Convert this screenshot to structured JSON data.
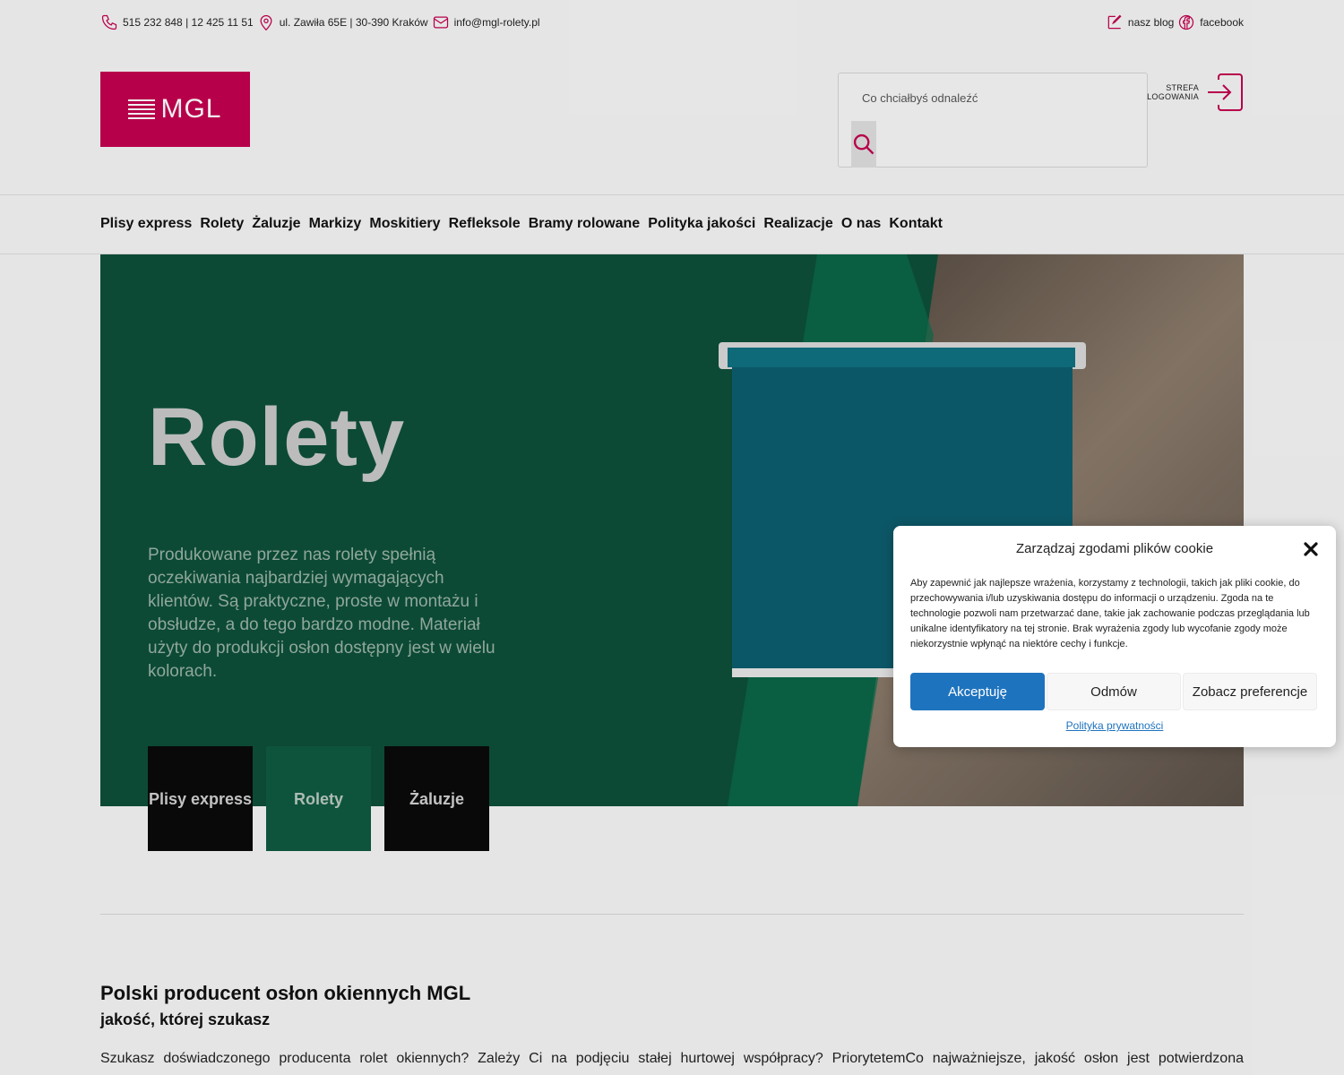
{
  "topbar": {
    "phone": "515 232 848 | 12 425 11 51",
    "address": "ul. Zawiła 65E | 30-390 Kraków",
    "email": "info@mgl-rolety.pl",
    "blog": "nasz blog",
    "facebook": "facebook"
  },
  "header": {
    "logo_text": "MGL",
    "search_placeholder": "Co chciałbyś odnaleźć",
    "login_line1": "STREFA",
    "login_line2": "LOGOWANIA"
  },
  "nav": {
    "items": [
      "Plisy express",
      "Rolety",
      "Żaluzje",
      "Markizy",
      "Moskitiery",
      "Refleksole",
      "Bramy rolowane",
      "Polityka jakości",
      "Realizacje",
      "O nas",
      "Kontakt"
    ]
  },
  "hero": {
    "title": "Rolety",
    "description": "Produkowane przez nas rolety spełnią oczekiwania najbardziej wymagających klientów. Są praktyczne, proste w montażu i obsłudze, a do tego bardzo modne. Materiał użyty do produkcji osłon dostępny jest w wielu kolorach.",
    "tiles": [
      "Plisy express",
      "Rolety",
      "Żaluzje"
    ]
  },
  "content": {
    "heading": "Polski producent osłon okiennych MGL",
    "subheading": "jakość, której szukasz",
    "paragraph": "Szukasz doświadczonego producenta rolet okiennych? Zależy Ci na podjęciu stałej hurtowej współpracy? PriorytetemCo najważniejsze, jakość osłon jest potwierdzona"
  },
  "cookie": {
    "title": "Zarządzaj zgodami plików cookie",
    "body": "Aby zapewnić jak najlepsze wrażenia, korzystamy z technologii, takich jak pliki cookie, do przechowywania i/lub uzyskiwania dostępu do informacji o urządzeniu. Zgoda na te technologie pozwoli nam przetwarzać dane, takie jak zachowanie podczas przeglądania lub unikalne identyfikatory na tej stronie. Brak wyrażenia zgody lub wycofanie zgody może niekorzystnie wpłynąć na niektóre cechy i funkcje.",
    "accept": "Akceptuję",
    "deny": "Odmów",
    "preferences": "Zobacz preferencje",
    "privacy_link": "Polityka prywatności"
  },
  "colors": {
    "brand": "#c3004f",
    "hero_green": "#0d4f39",
    "accept_blue": "#1e73be"
  }
}
